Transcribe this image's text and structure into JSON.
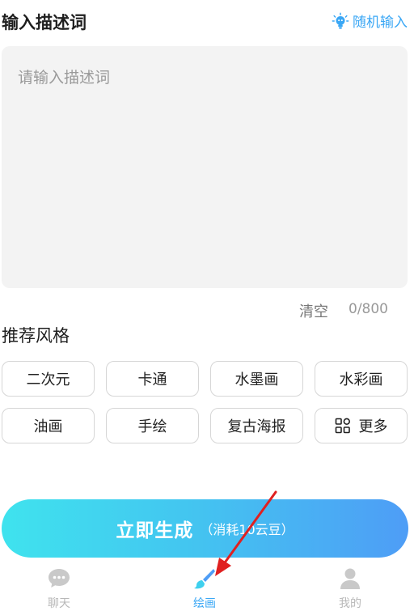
{
  "header": {
    "title": "输入描述词",
    "random_label": "随机输入",
    "random_icon": "lightbulb-icon"
  },
  "prompt": {
    "placeholder": "请输入描述词",
    "value": "",
    "clear_label": "清空",
    "counter": "0/800"
  },
  "styles": {
    "title": "推荐风格",
    "items": [
      {
        "label": "二次元"
      },
      {
        "label": "卡通"
      },
      {
        "label": "水墨画"
      },
      {
        "label": "水彩画"
      },
      {
        "label": "油画"
      },
      {
        "label": "手绘"
      },
      {
        "label": "复古海报"
      },
      {
        "label": "更多",
        "icon": "grid-icon"
      }
    ]
  },
  "generate": {
    "label": "立即生成",
    "cost": "（消耗10云豆）"
  },
  "tabs": [
    {
      "label": "聊天",
      "icon": "chat-icon",
      "active": false
    },
    {
      "label": "绘画",
      "icon": "brush-icon",
      "active": true
    },
    {
      "label": "我的",
      "icon": "user-icon",
      "active": false
    }
  ],
  "colors": {
    "accent": "#3aa7f5",
    "gradient_start": "#3fe3ee",
    "gradient_end": "#4e9df6",
    "arrow": "#e02020"
  }
}
